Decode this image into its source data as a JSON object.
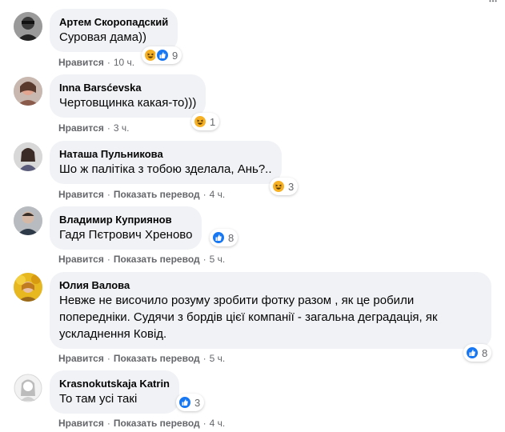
{
  "colors": {
    "bubble_bg": "#f0f2f5",
    "meta_text": "#65676b",
    "like_blue": "#1877f2",
    "haha_yellow": "#f7b125"
  },
  "actions": {
    "like": "Нравится",
    "translate": "Показать перевод",
    "separator": "·"
  },
  "comments": [
    {
      "author": "Артем Скоропадский",
      "text": "Суровая дама))",
      "time": "10 ч.",
      "reactions": [
        "haha-icon",
        "like-icon"
      ],
      "reaction_count": "9",
      "show_translate": false
    },
    {
      "author": "Inna Barsćevska",
      "text": "Чертовщинка какая-то)))",
      "time": "3 ч.",
      "reactions": [
        "haha-icon"
      ],
      "reaction_count": "1",
      "show_translate": false
    },
    {
      "author": "Наташа Пульникова",
      "text": "Шо ж палітіка з тобою зделала, Ань?..",
      "time": "4 ч.",
      "reactions": [
        "haha-icon"
      ],
      "reaction_count": "3",
      "show_translate": true
    },
    {
      "author": "Владимир Куприянов",
      "text": "Гадя Пєтрович Хреново",
      "time": "5 ч.",
      "reactions": [
        "like-icon"
      ],
      "reaction_count": "8",
      "show_translate": true
    },
    {
      "author": "Юлия Валова",
      "text": "Невже не височило розуму зробити фотку разом , як це робили\nпопередніки. Судячи з бордів цієї компанії - загальна деградація, як\nускладнення Ковід.",
      "time": "5 ч.",
      "reactions": [
        "like-icon"
      ],
      "reaction_count": "8",
      "show_translate": true
    },
    {
      "author": "Krasnokutskaja Katrin",
      "text": "То там усі такі",
      "time": "4 ч.",
      "reactions": [
        "like-icon"
      ],
      "reaction_count": "3",
      "show_translate": true
    }
  ]
}
